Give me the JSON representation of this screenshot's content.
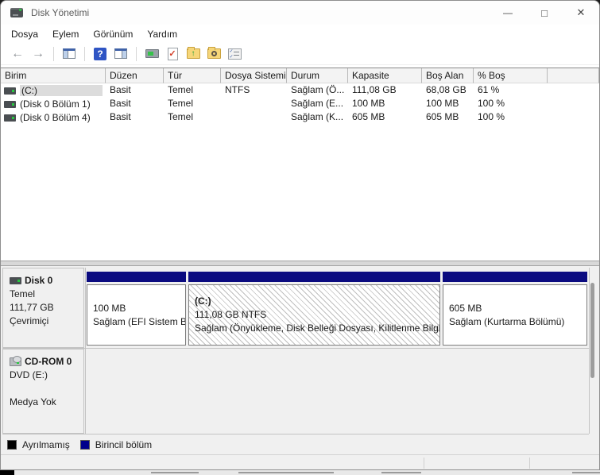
{
  "window": {
    "title": "Disk Yönetimi",
    "controls": {
      "minimize": "—",
      "maximize": "□",
      "close": "✕"
    }
  },
  "menu": {
    "items": {
      "dosya": "Dosya",
      "eylem": "Eylem",
      "gorunum": "Görünüm",
      "yardim": "Yardım"
    }
  },
  "toolbar": {
    "icons": [
      "back-icon",
      "forward-icon",
      "console-tree-icon",
      "help-icon",
      "action-pane-icon",
      "device-icon",
      "check-document-icon",
      "folder-up-icon",
      "folder-search-icon",
      "checklist-icon"
    ],
    "glyphs": {
      "back": "←",
      "forward": "→",
      "help": "?",
      "folder_up": "↑"
    }
  },
  "volume_table": {
    "columns": {
      "birim": "Birim",
      "duzen": "Düzen",
      "tur": "Tür",
      "dosya_sistemi": "Dosya Sistemi",
      "durum": "Durum",
      "kapasite": "Kapasite",
      "bos_alan": "Boş Alan",
      "yuzde_bos": "% Boş"
    },
    "rows": [
      {
        "birim": "(C:)",
        "duzen": "Basit",
        "tur": "Temel",
        "dosya_sistemi": "NTFS",
        "durum": "Sağlam (Ö...",
        "kapasite": "111,08 GB",
        "bos_alan": "68,08 GB",
        "yuzde_bos": "61 %"
      },
      {
        "birim": "(Disk 0 Bölüm 1)",
        "duzen": "Basit",
        "tur": "Temel",
        "dosya_sistemi": "",
        "durum": "Sağlam (E...",
        "kapasite": "100 MB",
        "bos_alan": "100 MB",
        "yuzde_bos": "100 %"
      },
      {
        "birim": "(Disk 0 Bölüm 4)",
        "duzen": "Basit",
        "tur": "Temel",
        "dosya_sistemi": "",
        "durum": "Sağlam (K...",
        "kapasite": "605 MB",
        "bos_alan": "605 MB",
        "yuzde_bos": "100 %"
      }
    ]
  },
  "graph": {
    "disk0": {
      "name": "Disk 0",
      "type": "Temel",
      "size": "111,77 GB",
      "status": "Çevrimiçi",
      "partitions": [
        {
          "label": "",
          "size_line": "100 MB",
          "status_line": "Sağlam (EFI Sistem Bö"
        },
        {
          "label": "(C:)",
          "size_line": "111,08 GB NTFS",
          "status_line": "Sağlam (Önyükleme, Disk Belleği Dosyası, Kilitlenme Bilgis"
        },
        {
          "label": "",
          "size_line": "605 MB",
          "status_line": "Sağlam (Kurtarma Bölümü)"
        }
      ]
    },
    "cdrom": {
      "name": "CD-ROM 0",
      "drive": "DVD (E:)",
      "status": "Medya Yok"
    }
  },
  "legend": {
    "unallocated_label": "Ayrılmamış",
    "primary_label": "Birincil bölüm",
    "colors": {
      "unallocated": "#000000",
      "primary": "#00008b",
      "partition_header": "#0b0b80"
    }
  }
}
